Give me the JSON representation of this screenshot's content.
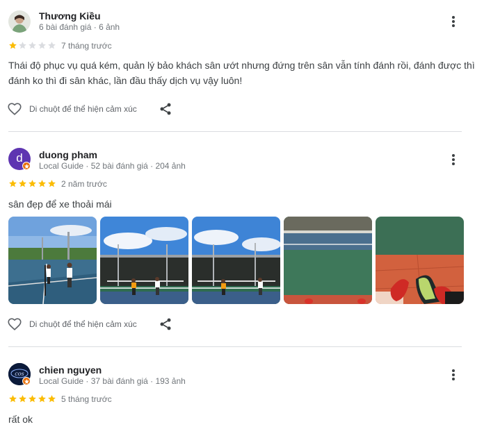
{
  "reviews": [
    {
      "name": "Thương Kiều",
      "meta": "6 bài đánh giá · 6 ảnh",
      "rating": 1,
      "time": "7 tháng trước",
      "text": "Thái độ phục vụ quá kém, quản lý bảo khách sân ướt nhưng đứng trên sân vẫn tính đánh rồi, đánh được thì đánh ko thì đi sân khác, lần đầu thấy dịch vụ vậy luôn!",
      "react_label": "Di chuột để thể hiện cảm xúc"
    },
    {
      "name": "duong pham",
      "meta": "Local Guide · 52 bài đánh giá · 204 ảnh",
      "avatar_letter": "d",
      "rating": 5,
      "time": "2 năm trước",
      "text": "sân đẹp để xe thoải mái",
      "react_label": "Di chuột để thể hiện cảm xúc",
      "photos": [
        "tennis-court-players",
        "tennis-court-net",
        "tennis-court-net",
        "tennis-court-surface",
        "feet-on-court"
      ]
    },
    {
      "name": "chien nguyen",
      "meta": "Local Guide · 37 bài đánh giá · 193 ảnh",
      "rating": 5,
      "time": "5 tháng trước",
      "text": "rất ok"
    }
  ],
  "colors": {
    "star_filled": "#fbbc04",
    "star_empty": "#dadce0",
    "avatar_purple": "#5e35b1",
    "badge_orange": "#e8710a",
    "divider": "#dadce0"
  },
  "icons": [
    "more-vert-icon",
    "heart-outline-icon",
    "share-icon",
    "star-icon",
    "local-guide-badge-icon"
  ]
}
